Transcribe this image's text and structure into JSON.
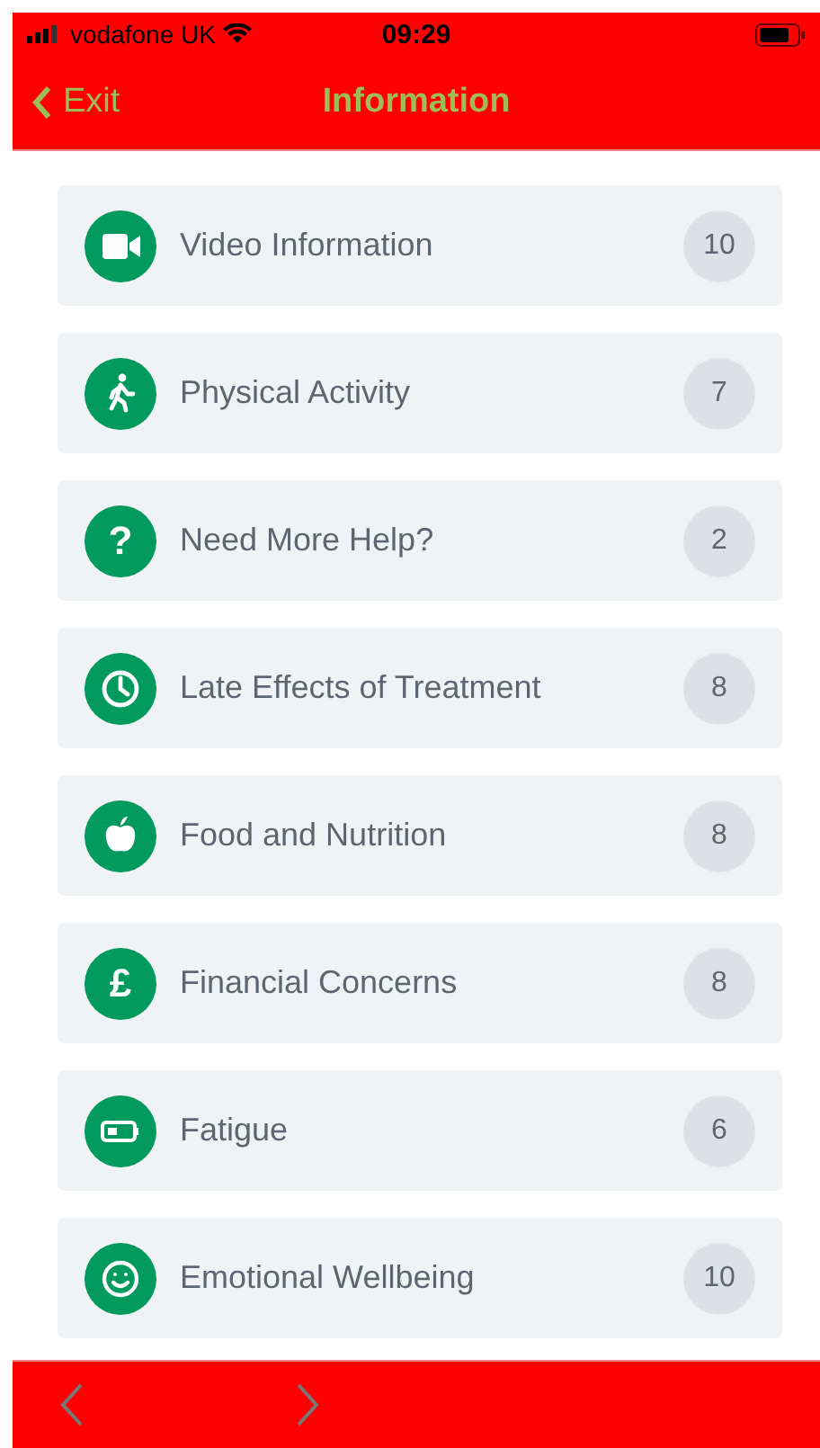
{
  "status_bar": {
    "carrier": "vodafone UK",
    "time": "09:29"
  },
  "nav_bar": {
    "back_label": "Exit",
    "title": "Information"
  },
  "items": [
    {
      "kind": "video",
      "label": "Video Information",
      "count": "10"
    },
    {
      "kind": "walk",
      "label": "Physical Activity",
      "count": "7"
    },
    {
      "kind": "glyph",
      "glyph": "?",
      "label": "Need More Help?",
      "count": "2"
    },
    {
      "kind": "clock",
      "label": "Late Effects of Treatment",
      "count": "8"
    },
    {
      "kind": "apple",
      "label": "Food and Nutrition",
      "count": "8"
    },
    {
      "kind": "glyph",
      "glyph": "£",
      "label": "Financial Concerns",
      "count": "8"
    },
    {
      "kind": "battery",
      "label": "Fatigue",
      "count": "6"
    },
    {
      "kind": "smile",
      "label": "Emotional Wellbeing",
      "count": "10"
    }
  ],
  "toolbar": {
    "back_disabled": true,
    "forward_disabled": true
  }
}
